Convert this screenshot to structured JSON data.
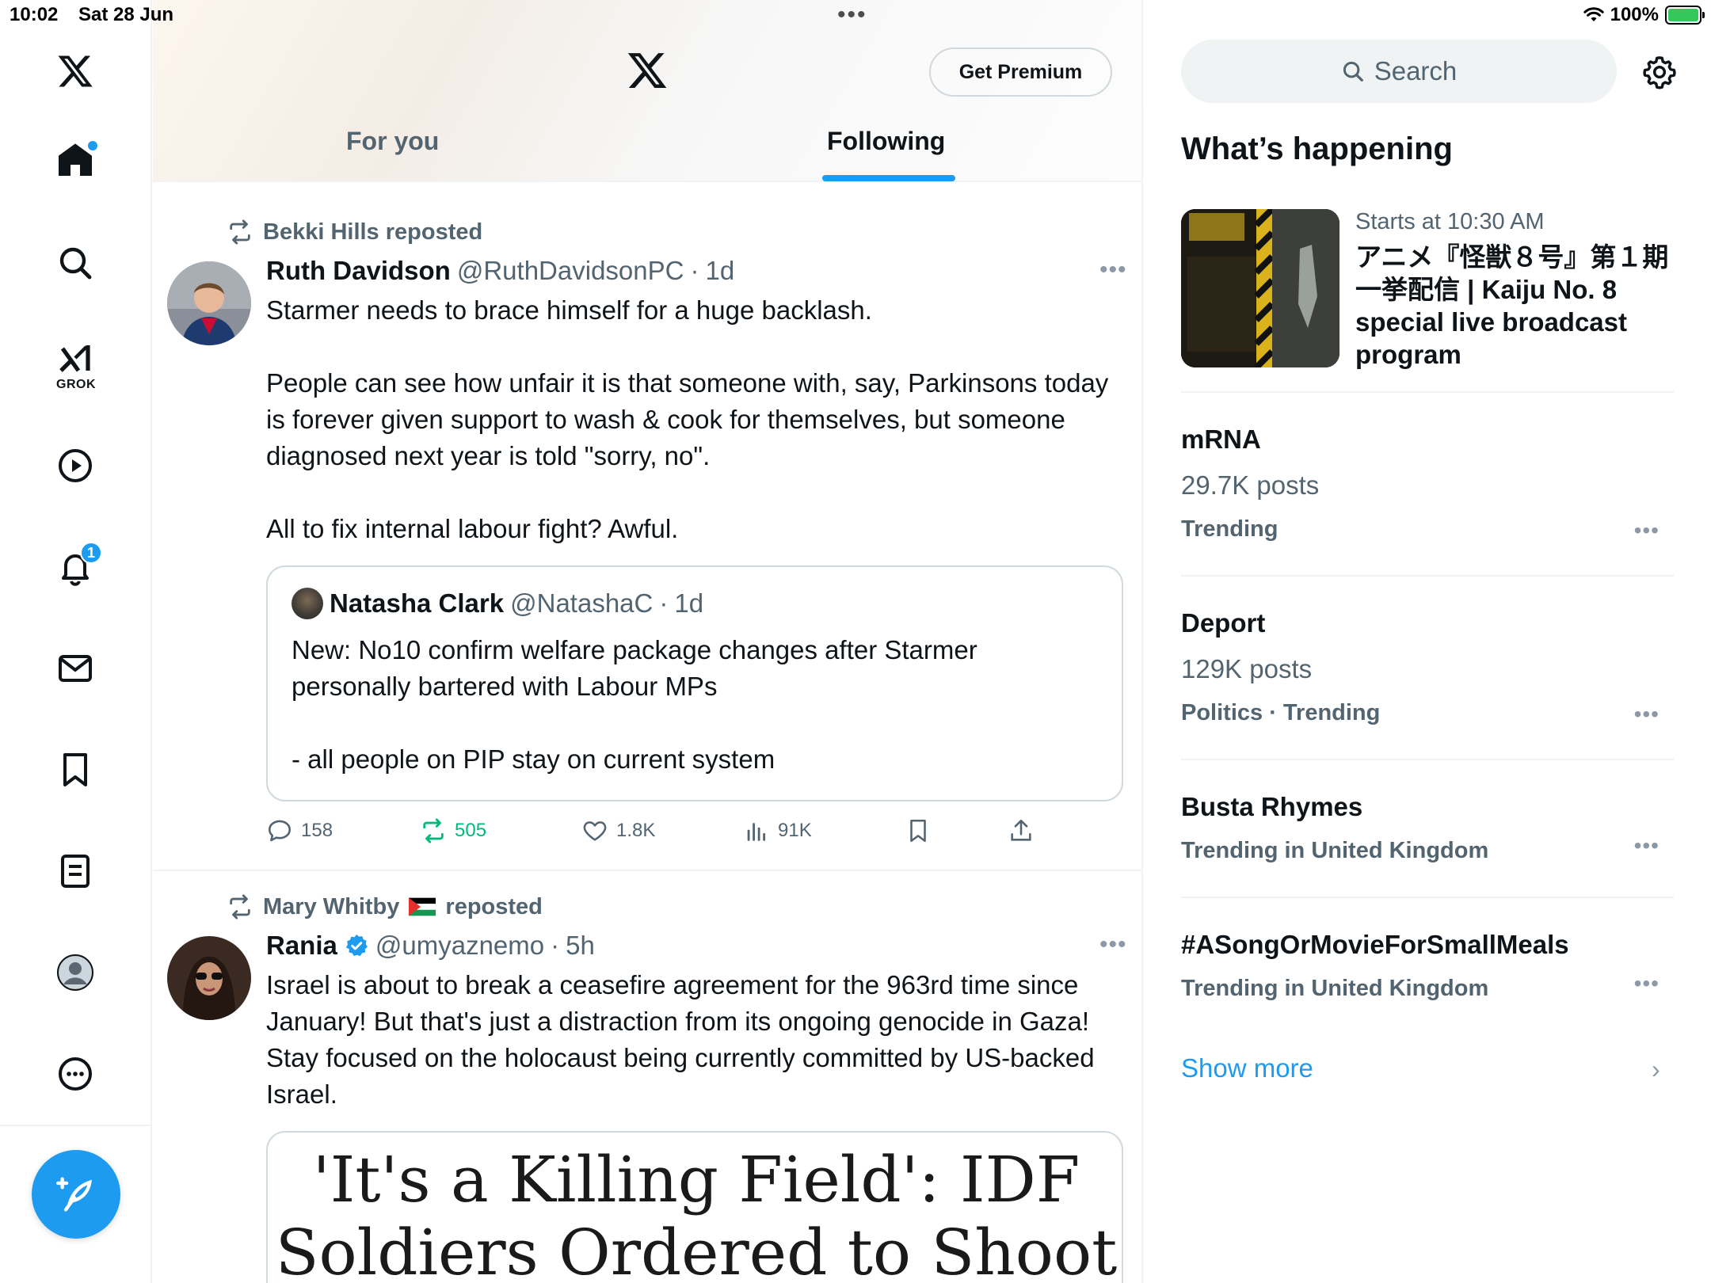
{
  "status_bar": {
    "time": "10:02",
    "date": "Sat 28 Jun",
    "battery": "100%"
  },
  "nav": {
    "grok_label": "GROK",
    "notifications_badge": "1"
  },
  "header": {
    "premium_label": "Get Premium",
    "tabs": [
      "For you",
      "Following"
    ],
    "active_tab": "Following"
  },
  "tweets": [
    {
      "repost_by": "Bekki Hills reposted",
      "name": "Ruth Davidson",
      "handle": "@RuthDavidsonPC",
      "sep": "·",
      "time": "1d",
      "text": "Starmer needs to brace himself for a huge backlash.\n\nPeople can see how unfair it is that someone with, say, Parkinsons today is forever given support to wash & cook for themselves, but someone diagnosed next year is told \"sorry, no\".\n\nAll to fix internal labour fight? Awful.",
      "quote": {
        "name": "Natasha Clark",
        "handle": "@NatashaC",
        "sep": "·",
        "time": "1d",
        "text": "New: No10 confirm welfare package changes after Starmer personally bartered with Labour MPs\n\n- all people on PIP stay on current system"
      },
      "stats": {
        "replies": "158",
        "reposts": "505",
        "likes": "1.8K",
        "views": "91K"
      }
    },
    {
      "repost_by": "Mary Whitby",
      "repost_suffix": "reposted",
      "name": "Rania",
      "handle": "@umyaznemo",
      "sep": "·",
      "time": "5h",
      "verified": true,
      "text": "Israel is about to break a ceasefire agreement for the 963rd time since January! But that's just a distraction from its ongoing genocide in Gaza! Stay focused on the holocaust being currently committed by US-backed Israel.",
      "media_text": "'It's a Killing Field': IDF\nSoldiers Ordered to Shoot"
    }
  ],
  "sidebar": {
    "search_placeholder": "Search",
    "title": "What’s happening",
    "event": {
      "meta": "Starts at 10:30 AM",
      "title": "アニメ『怪獣８号』第１期一挙配信 | Kaiju No. 8 special live broadcast program"
    },
    "trends": [
      {
        "name": "mRNA",
        "count": "29.7K posts",
        "category": "Trending"
      },
      {
        "name": "Deport",
        "count": "129K posts",
        "category": "Politics · Trending"
      },
      {
        "name": "Busta Rhymes",
        "category": "Trending in United Kingdom"
      },
      {
        "name": "#ASongOrMovieForSmallMeals",
        "category": "Trending in United Kingdom"
      }
    ],
    "show_more": "Show more"
  },
  "colors": {
    "accent": "#1d9bf0",
    "repost_green": "#00ba7c",
    "secondary_text": "#536471",
    "border": "#eff3f4"
  }
}
